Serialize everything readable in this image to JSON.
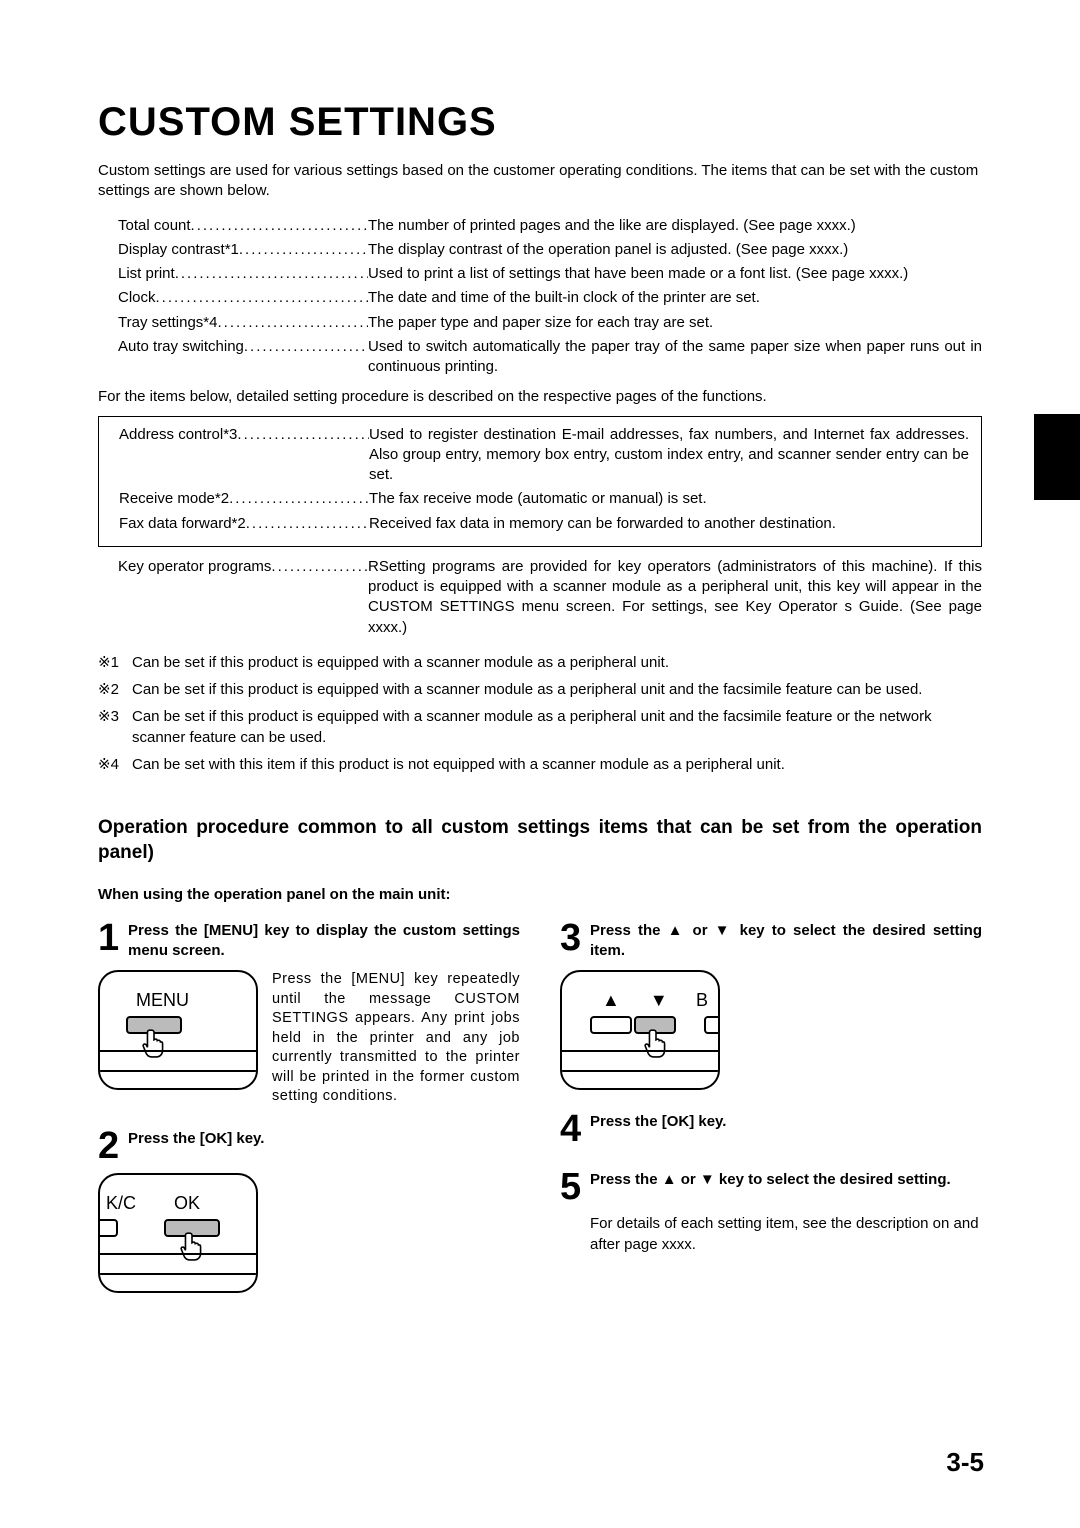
{
  "title": "CUSTOM SETTINGS",
  "intro": "Custom settings are used for various settings based on the customer operating conditions. The items that can be set with the custom settings are shown below.",
  "items1": [
    {
      "label": "Total count",
      "desc": "The number of printed pages and the like are displayed. (See page xxxx.)"
    },
    {
      "label": "Display contrast*1",
      "desc": "The display contrast of the operation panel is adjusted. (See page xxxx.)"
    },
    {
      "label": "List print",
      "desc": "Used to print a list of settings that have been made or a font list. (See page xxxx.)"
    },
    {
      "label": "Clock",
      "desc": "The date and time of the built-in clock of the printer are set."
    },
    {
      "label": "Tray settings*4",
      "desc": "The paper type and paper size for each tray are set."
    },
    {
      "label": "Auto tray switching",
      "desc": "Used to switch automatically the paper tray of the same paper size when paper runs out in continuous printing."
    }
  ],
  "note_between": "For the items below, detailed setting procedure is described on the respective pages of the functions.",
  "items2": [
    {
      "label": "Address control*3",
      "desc": "Used to register destination E-mail addresses, fax numbers, and Internet fax addresses. Also group entry, memory box entry, custom index entry, and scanner sender entry can be set."
    },
    {
      "label": "Receive mode*2",
      "desc": "The fax receive mode (automatic or manual) is set."
    },
    {
      "label": "Fax data forward*2",
      "desc": "Received fax data in memory can be forwarded to another destination."
    }
  ],
  "items3": [
    {
      "label": "Key operator programs",
      "desc": "RSetting programs are provided for key operators (administrators of this machine). If this product is equipped with a scanner module as a peripheral unit, this key will appear in the CUSTOM SETTINGS menu screen. For settings, see Key Operator s Guide. (See page xxxx.)"
    }
  ],
  "footnotes": [
    {
      "mark": "※1",
      "text": "Can be set if this product is equipped with a scanner module as a peripheral unit."
    },
    {
      "mark": "※2",
      "text": "Can be set if this product is equipped with a scanner module as a peripheral unit and the facsimile feature can be used."
    },
    {
      "mark": "※3",
      "text": "Can be set if this product is equipped with a scanner module as a peripheral unit and the facsimile feature or the network scanner feature can be used."
    },
    {
      "mark": "※4",
      "text": "Can be set with this item if this product is not equipped with a scanner module as a peripheral unit."
    }
  ],
  "section_head": "Operation procedure common to all custom settings items that can be set from the operation panel)",
  "subhead": "When using the operation panel on the main unit:",
  "step1": {
    "title": "Press the [MENU] key to display the custom settings menu screen.",
    "desc": "Press the [MENU] key repeatedly until the message CUSTOM SETTINGS appears. Any print jobs held in the printer and any job currently transmitted to the printer will be printed in the former custom setting conditions.",
    "label": "MENU"
  },
  "step2": {
    "title": "Press the [OK] key.",
    "kc": "K/C",
    "ok": "OK"
  },
  "step3": {
    "title": "Press the ▲ or ▼ key to select the desired setting item.",
    "arrows": "▲▼",
    "b": "B"
  },
  "step4": {
    "title": "Press the [OK] key."
  },
  "step5": {
    "title": "Press the ▲ or ▼ key to select the desired setting.",
    "note": "For details of each setting item, see the description on and after page xxxx."
  },
  "page_number": "3-5"
}
